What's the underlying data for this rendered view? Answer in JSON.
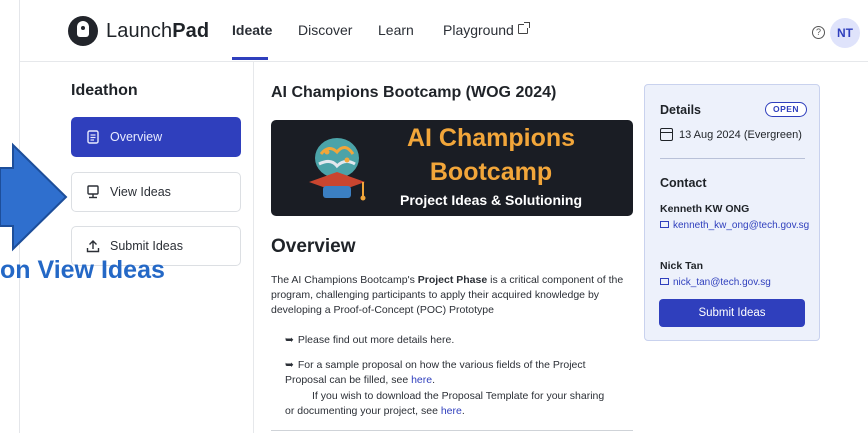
{
  "brand": {
    "name_light": "Launch",
    "name_bold": "Pad"
  },
  "nav": {
    "tabs": [
      {
        "label": "Ideate",
        "active": true
      },
      {
        "label": "Discover"
      },
      {
        "label": "Learn"
      },
      {
        "label": "Playground",
        "icon": "external-link-icon"
      }
    ],
    "help_glyph": "?",
    "avatar_initials": "NT"
  },
  "sidebar": {
    "title": "Ideathon",
    "items": [
      {
        "label": "Overview",
        "icon": "document-icon",
        "active": true
      },
      {
        "label": "View Ideas",
        "icon": "monitor-icon"
      },
      {
        "label": "Submit Ideas",
        "icon": "upload-icon"
      }
    ]
  },
  "annotation": {
    "text": "on View Ideas"
  },
  "main": {
    "title": "AI Champions Bootcamp (WOG 2024)",
    "banner": {
      "line1": "AI Champions",
      "line2": "Bootcamp",
      "line3": "Project Ideas & Solutioning"
    },
    "section_heading": "Overview",
    "paragraph": {
      "pre": "The AI Champions Bootcamp's ",
      "bold": "Project Phase",
      "post": " is a critical component of the program, challenging participants to apply their acquired knowledge by developing a Proof-of-Concept (POC) Prototype"
    },
    "bullets": [
      {
        "mark": "➥",
        "text": "Please find out more details here."
      },
      {
        "mark": "➥",
        "text": "For a sample proposal on how the various fields of the Project Proposal can be filled, see ",
        "link": "here",
        "after": "."
      },
      {
        "text": "If you wish to download the Proposal Template for your sharing or documenting your project, see ",
        "link": "here",
        "after": "."
      }
    ]
  },
  "details": {
    "heading": "Details",
    "status_badge": "OPEN",
    "date": "13 Aug 2024 (Evergreen)",
    "contact_heading": "Contact",
    "contacts": [
      {
        "name": "Kenneth KW ONG",
        "email": "kenneth_kw_ong@tech.gov.sg"
      },
      {
        "name": "Nick Tan",
        "email": "nick_tan@tech.gov.sg"
      }
    ],
    "submit_label": "Submit Ideas"
  },
  "colors": {
    "primary": "#2f3fbd",
    "banner_bg": "#1a1d24",
    "banner_accent": "#f2a63a",
    "card_bg": "#edf1fb",
    "annotation_blue": "#2468c6"
  }
}
